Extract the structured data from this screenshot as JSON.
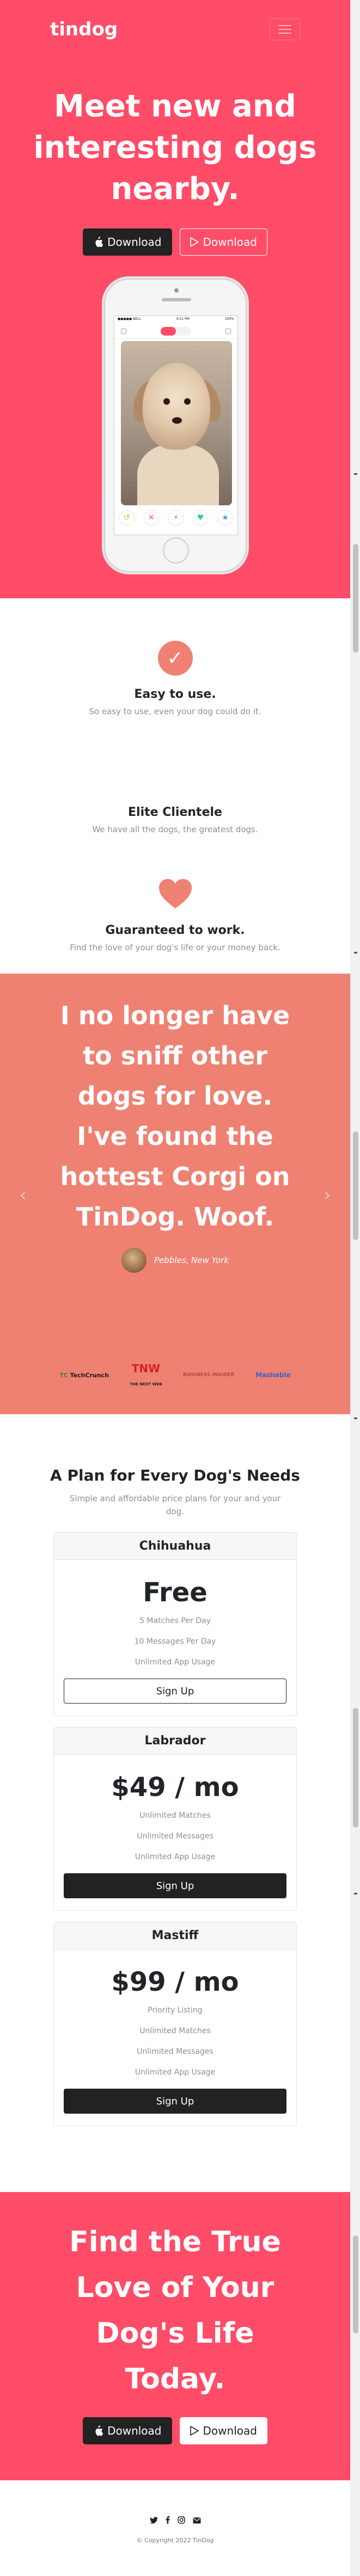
{
  "navbar": {
    "brand": "tindog"
  },
  "title": {
    "heading": "Meet new and interesting dogs nearby.",
    "buttons": [
      {
        "label": "Download",
        "icon": "apple-icon"
      },
      {
        "label": "Download",
        "icon": "google-play-icon"
      }
    ]
  },
  "phone": {
    "status_left": "●●●●● BELL",
    "status_time": "4:21 PM",
    "status_right": "100%"
  },
  "features": [
    {
      "title": "Easy to use.",
      "text": "So easy to use, even your dog could do it.",
      "icon": "check-circle-icon"
    },
    {
      "title": "Elite Clientele",
      "text": "We have all the dogs, the greatest dogs.",
      "icon": "bullseye-icon"
    },
    {
      "title": "Guaranteed to work.",
      "text": "Find the love of your dog's life or your money back.",
      "icon": "heart-icon"
    }
  ],
  "testimonial": {
    "quote": "I no longer have to sniff other dogs for love. I've found the hottest Corgi on TinDog. Woof.",
    "author": "Pebbles, New York"
  },
  "press": [
    {
      "name": "TechCrunch",
      "text": "TC",
      "sub": "TechCrunch"
    },
    {
      "name": "TNW",
      "text": "TNW",
      "sub": "THE NEXT WEB"
    },
    {
      "name": "Business Insider",
      "text": "BUSINESS INSIDER"
    },
    {
      "name": "Mashable",
      "text": "Mashable"
    }
  ],
  "pricing": {
    "heading": "A Plan for Every Dog's Needs",
    "subheading": "Simple and affordable price plans for your and your dog.",
    "plans": [
      {
        "name": "Chihuahua",
        "price": "Free",
        "features": [
          "5 Matches Per Day",
          "10 Messages Per Day",
          "Unlimited App Usage"
        ],
        "button": "Sign Up"
      },
      {
        "name": "Labrador",
        "price": "$49 / mo",
        "features": [
          "Unlimited Matches",
          "Unlimited Messages",
          "Unlimited App Usage"
        ],
        "button": "Sign Up"
      },
      {
        "name": "Mastiff",
        "price": "$99 / mo",
        "features": [
          "Priority Listing",
          "Unlimited Matches",
          "Unlimited Messages",
          "Unlimited App Usage"
        ],
        "button": "Sign Up"
      }
    ]
  },
  "cta": {
    "heading": "Find the True Love of Your Dog's Life Today.",
    "buttons": [
      {
        "label": "Download",
        "icon": "apple-icon"
      },
      {
        "label": "Download",
        "icon": "google-play-icon"
      }
    ]
  },
  "footer": {
    "social": [
      "twitter-icon",
      "facebook-icon",
      "instagram-icon",
      "envelope-icon"
    ],
    "copyright": "© Copyright 2022 TinDog"
  },
  "colors": {
    "primary": "#ff4c68",
    "secondary": "#ef8172",
    "dark": "#222222"
  }
}
